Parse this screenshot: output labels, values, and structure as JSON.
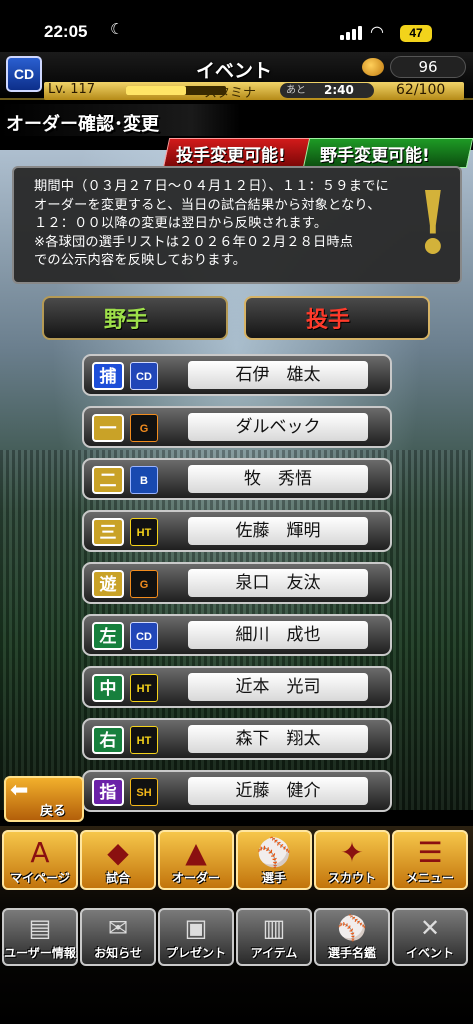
{
  "status_bar": {
    "time": "22:05",
    "battery": "47"
  },
  "header": {
    "team_logo": "CD",
    "title": "イベント",
    "coins": "96",
    "level_label": "Lv. 117",
    "level_progress": 0.6,
    "stamina_label": "スタミナ",
    "remaining_label": "あと",
    "remaining_time": "2:40",
    "stamina_value": "62/100"
  },
  "page": {
    "title": "オーダー確認･変更",
    "pitcher_change": "投手変更可能!",
    "fielder_change": "野手変更可能!"
  },
  "notice": {
    "text": "期間中（０３月２７日～０４月１２日）、１１：５９までに\nオーダーを変更すると、当日の試合結果から対象となり、\n１２：００以降の変更は翌日から反映されます。\n※各球団の選手リストは２０２６年０２月２８日時点\nでの公示内容を反映しております。",
    "icon": "exclamation-icon"
  },
  "tabs": {
    "fielder": "野手",
    "pitcher": "投手"
  },
  "roster": [
    {
      "position": "捕",
      "team": "CD",
      "name": "石伊　雄太"
    },
    {
      "position": "一",
      "team": "G",
      "name": "ダルベック"
    },
    {
      "position": "二",
      "team": "B",
      "name": "牧　秀悟"
    },
    {
      "position": "三",
      "team": "HT",
      "name": "佐藤　輝明"
    },
    {
      "position": "遊",
      "team": "G",
      "name": "泉口　友汰"
    },
    {
      "position": "左",
      "team": "CD",
      "name": "細川　成也"
    },
    {
      "position": "中",
      "team": "HT",
      "name": "近本　光司"
    },
    {
      "position": "右",
      "team": "HT",
      "name": "森下　翔太"
    },
    {
      "position": "指",
      "team": "SH",
      "name": "近藤　健介"
    }
  ],
  "back_label": "戻る",
  "nav_primary": [
    {
      "label": "マイページ",
      "icon": "home-icon"
    },
    {
      "label": "試合",
      "icon": "stadium-icon"
    },
    {
      "label": "オーダー",
      "icon": "order-icon"
    },
    {
      "label": "選手",
      "icon": "player-icon"
    },
    {
      "label": "スカウト",
      "icon": "scout-icon"
    },
    {
      "label": "メニュー",
      "icon": "menu-icon"
    }
  ],
  "nav_secondary": [
    {
      "label": "ユーザー情報",
      "icon": "user-info-icon"
    },
    {
      "label": "お知らせ",
      "icon": "news-icon"
    },
    {
      "label": "プレゼント",
      "icon": "gift-icon"
    },
    {
      "label": "アイテム",
      "icon": "item-icon"
    },
    {
      "label": "選手名鑑",
      "icon": "directory-icon"
    },
    {
      "label": "イベント",
      "icon": "event-icon"
    }
  ],
  "colors": {
    "pos_infield": "#c9a227",
    "pos_catcher": "#1d4ed8",
    "pos_outfield": "#17803d",
    "pos_dh": "#6b21a8"
  }
}
